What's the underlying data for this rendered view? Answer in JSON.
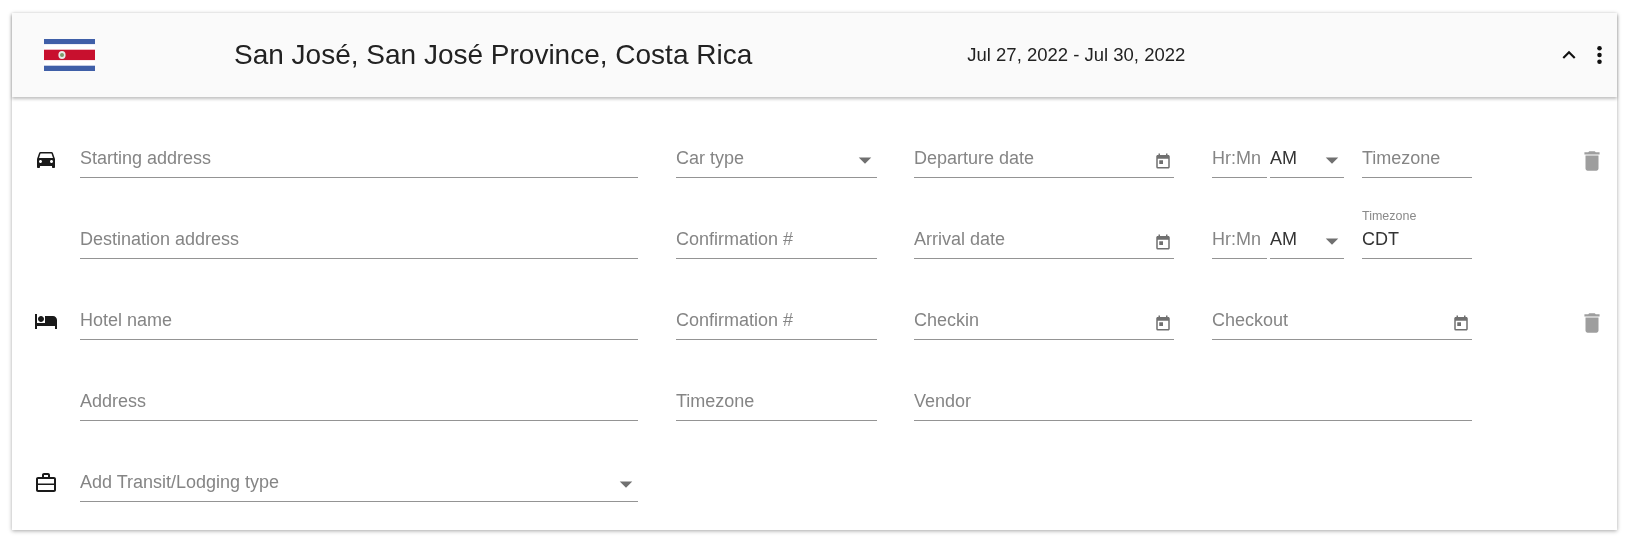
{
  "header": {
    "title": "San José, San José Province, Costa Rica",
    "dates": "Jul 27, 2022 - Jul 30, 2022",
    "expanded": true
  },
  "rows": [
    {
      "kind": "car",
      "deletable": true,
      "fields": [
        {
          "kind": "text",
          "placeholder": "Starting address"
        },
        {
          "kind": "select",
          "placeholder": "Car type"
        },
        {
          "kind": "date",
          "placeholder": "Departure date"
        },
        {
          "kind": "text",
          "placeholder": "Hr:Mn"
        },
        {
          "kind": "select",
          "value": "AM"
        },
        {
          "kind": "text",
          "placeholder": "Timezone"
        }
      ]
    },
    {
      "kind": "plain",
      "deletable": false,
      "fields": [
        {
          "kind": "text",
          "placeholder": "Destination address"
        },
        {
          "kind": "text",
          "placeholder": "Confirmation #"
        },
        {
          "kind": "date",
          "placeholder": "Arrival date"
        },
        {
          "kind": "text",
          "placeholder": "Hr:Mn"
        },
        {
          "kind": "select",
          "value": "AM"
        },
        {
          "kind": "text",
          "label": "Timezone",
          "value": "CDT"
        }
      ]
    },
    {
      "kind": "hotel",
      "deletable": true,
      "fields": [
        {
          "kind": "text",
          "placeholder": "Hotel name"
        },
        {
          "kind": "text",
          "placeholder": "Confirmation #"
        },
        {
          "kind": "date",
          "placeholder": "Checkin"
        },
        {
          "kind": "date",
          "placeholder": "Checkout"
        }
      ]
    },
    {
      "kind": "plain",
      "deletable": false,
      "fields": [
        {
          "kind": "text",
          "placeholder": "Address"
        },
        {
          "kind": "text",
          "placeholder": "Timezone"
        },
        {
          "kind": "text",
          "placeholder": "Vendor"
        }
      ]
    },
    {
      "kind": "add",
      "deletable": false,
      "fields": [
        {
          "kind": "select",
          "placeholder": "Add Transit/Lodging type"
        }
      ]
    }
  ]
}
